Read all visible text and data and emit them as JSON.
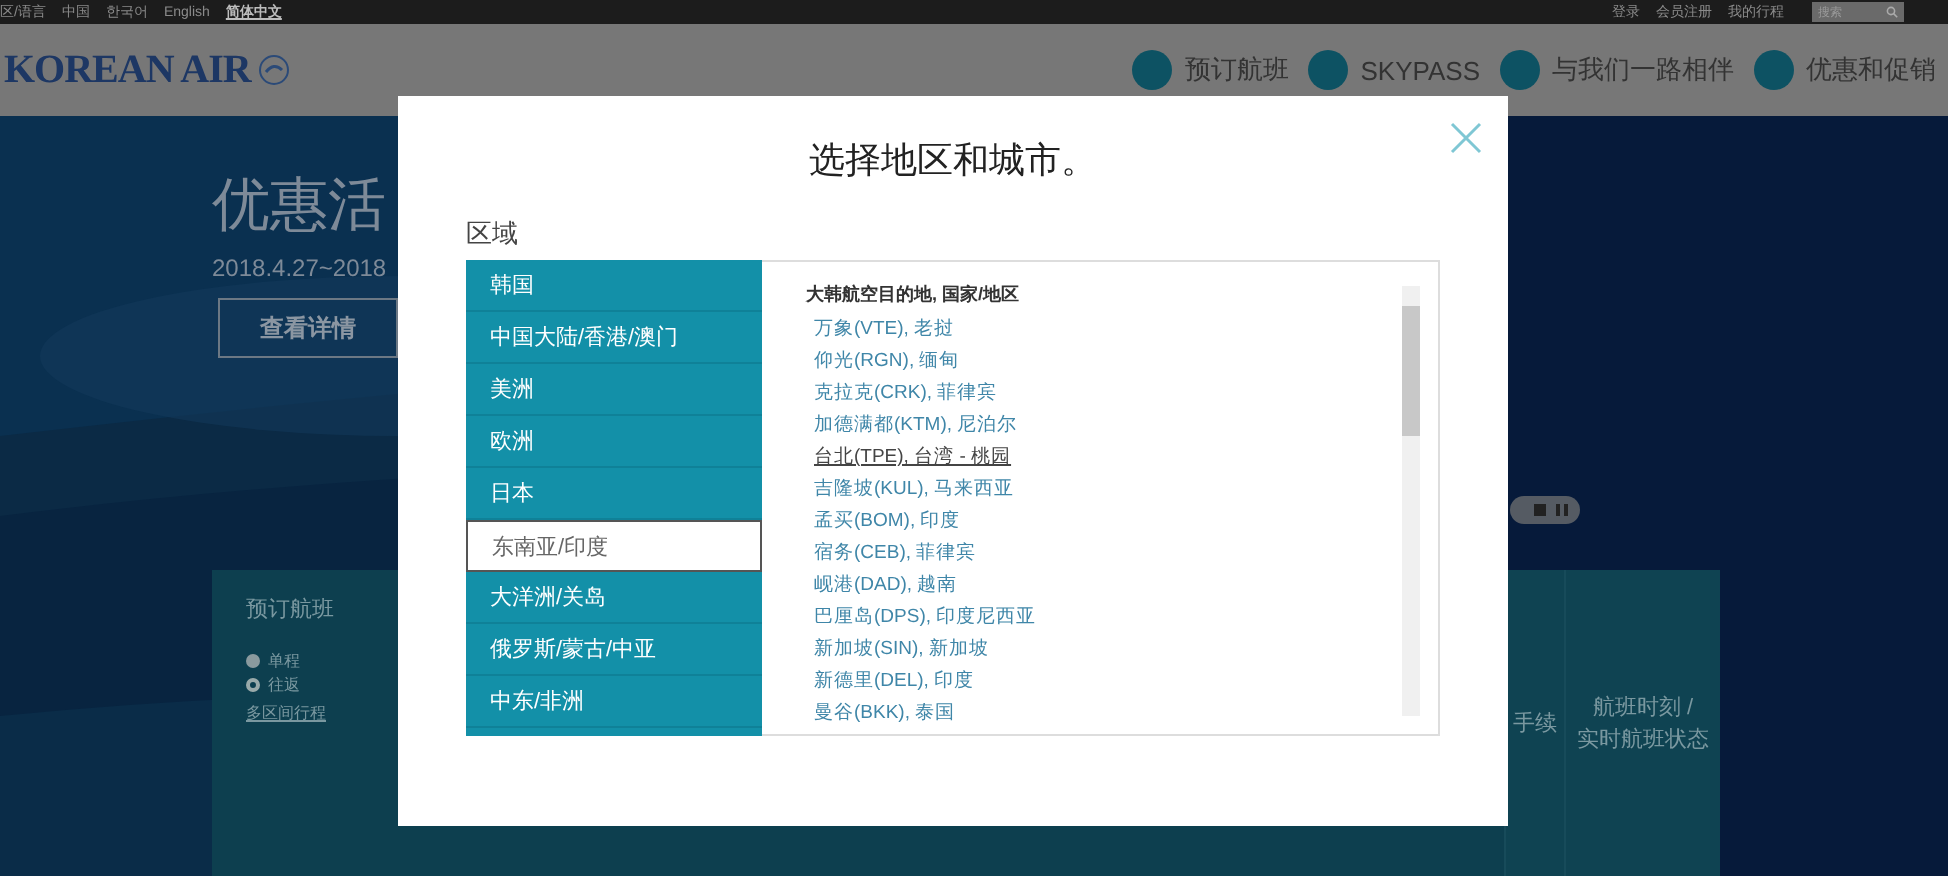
{
  "top_bar": {
    "region_label": "区/语言",
    "languages": [
      {
        "label": "中国",
        "selected": false
      },
      {
        "label": "한국어",
        "selected": false
      },
      {
        "label": "English",
        "selected": false
      },
      {
        "label": "简体中文",
        "selected": true
      }
    ],
    "links": [
      "登录",
      "会员注册",
      "我的行程"
    ],
    "search": {
      "placeholder": "搜索"
    }
  },
  "header": {
    "logo": "KOREAN AIR",
    "nav": [
      "预订航班",
      "SKYPASS",
      "与我们一路相伴",
      "优惠和促销"
    ]
  },
  "hero": {
    "title": "优惠活",
    "date": "2018.4.27~2018",
    "button": "查看详情"
  },
  "booking": {
    "title": "预订航班",
    "trip_types": [
      {
        "label": "单程",
        "selected": false
      },
      {
        "label": "往返",
        "selected": true
      }
    ],
    "multi_city": "多区间行程",
    "right_tabs": [
      "手续",
      "航班时刻 /\n实时航班状态"
    ]
  },
  "modal": {
    "title": "选择地区和城市。",
    "region_label": "区域",
    "regions": [
      {
        "label": "韩国",
        "selected": false
      },
      {
        "label": "中国大陆/香港/澳门",
        "selected": false
      },
      {
        "label": "美洲",
        "selected": false
      },
      {
        "label": "欧洲",
        "selected": false
      },
      {
        "label": "日本",
        "selected": false
      },
      {
        "label": "东南亚/印度",
        "selected": true
      },
      {
        "label": "大洋洲/关岛",
        "selected": false
      },
      {
        "label": "俄罗斯/蒙古/中亚",
        "selected": false
      },
      {
        "label": "中东/非洲",
        "selected": false
      }
    ],
    "cities_heading": "大韩航空目的地, 国家/地区",
    "cities": [
      {
        "label": "万象(VTE), 老挝",
        "hovered": false
      },
      {
        "label": "仰光(RGN), 缅甸",
        "hovered": false
      },
      {
        "label": "克拉克(CRK), 菲律宾",
        "hovered": false
      },
      {
        "label": "加德满都(KTM), 尼泊尔",
        "hovered": false
      },
      {
        "label": "台北(TPE), 台湾 - 桃园",
        "hovered": true
      },
      {
        "label": "吉隆坡(KUL), 马来西亚",
        "hovered": false
      },
      {
        "label": "孟买(BOM), 印度",
        "hovered": false
      },
      {
        "label": "宿务(CEB), 菲律宾",
        "hovered": false
      },
      {
        "label": "岘港(DAD), 越南",
        "hovered": false
      },
      {
        "label": "巴厘岛(DPS), 印度尼西亚",
        "hovered": false
      },
      {
        "label": "新加坡(SIN), 新加坡",
        "hovered": false
      },
      {
        "label": "新德里(DEL), 印度",
        "hovered": false
      },
      {
        "label": "曼谷(BKK), 泰国",
        "hovered": false
      }
    ]
  }
}
